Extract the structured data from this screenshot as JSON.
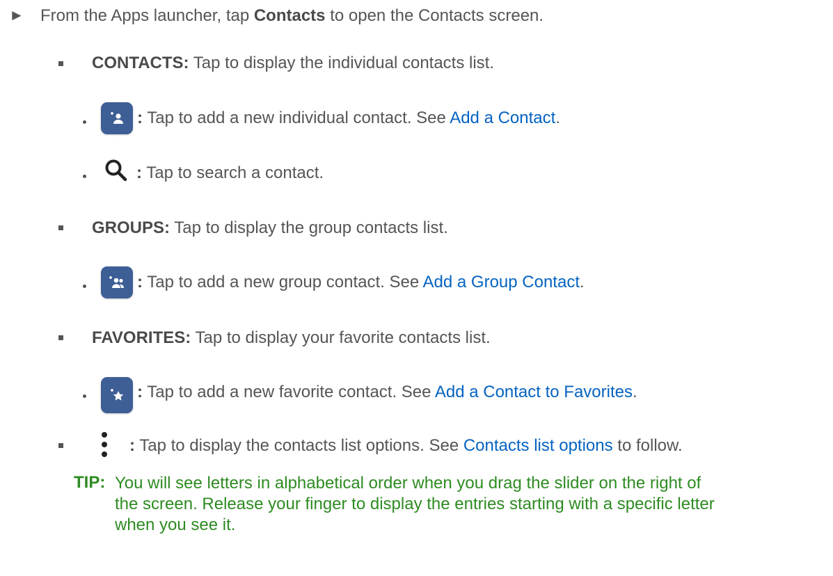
{
  "intro": {
    "prefix": "From the Apps launcher, tap ",
    "bold": "Contacts",
    "suffix": " to open the Contacts screen."
  },
  "contacts_item": {
    "label": "CONTACTS:",
    "text": " Tap to display the individual contacts list."
  },
  "add_contact": {
    "icon": "add-person-icon",
    "colon": ":",
    "text": " Tap to add a new individual contact. See ",
    "link": "Add a Contact",
    "end": "."
  },
  "search": {
    "icon": "search-icon",
    "colon": ":",
    "text": " Tap to search a contact."
  },
  "groups_item": {
    "label": "GROUPS:",
    "text": " Tap to display the group contacts list."
  },
  "add_group": {
    "icon": "add-group-icon",
    "colon": ":",
    "text": " Tap to add a new group contact. See ",
    "link": "Add a Group Contact",
    "end": "."
  },
  "favorites_item": {
    "label": "FAVORITES:",
    "text": " Tap to display your favorite contacts list."
  },
  "add_favorite": {
    "icon": "add-star-icon",
    "colon": ":",
    "text": " Tap to add a new favorite contact. See ",
    "link": "Add a Contact to Favorites",
    "end": "."
  },
  "options_item": {
    "icon": "more-vertical-icon",
    "colon": ":",
    "text": " Tap to display the contacts list options. See ",
    "link": "Contacts list options",
    "end": " to follow."
  },
  "tip": {
    "label": "TIP:",
    "line1": "You will see letters in alphabetical order when you drag the slider on the right of",
    "line2": "the screen. Release your finger to display the entries starting with a specific letter",
    "line3": "when you see it."
  },
  "colors": {
    "body_text": "#555555",
    "link": "#0563c1",
    "tip": "#2e8b22",
    "icon_button": "#3e5f96"
  }
}
